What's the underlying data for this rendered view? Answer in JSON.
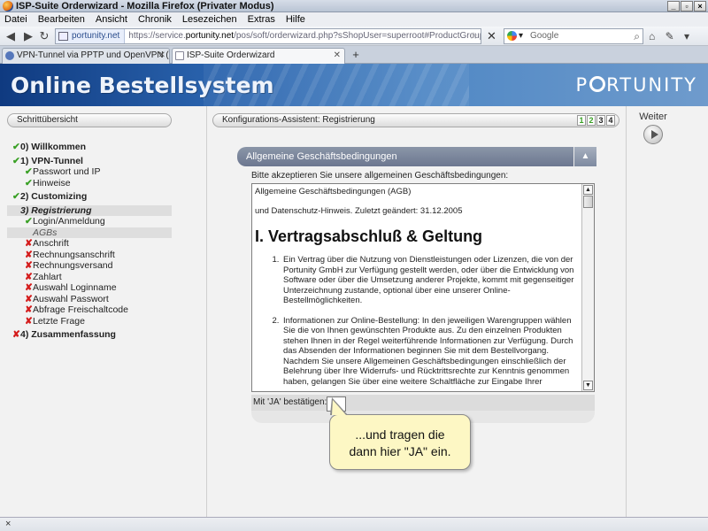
{
  "window": {
    "title": "ISP-Suite Orderwizard - Mozilla Firefox (Privater Modus)",
    "controls": [
      "_",
      "▫",
      "×"
    ]
  },
  "menu": [
    "Datei",
    "Bearbeiten",
    "Ansicht",
    "Chronik",
    "Lesezeichen",
    "Extras",
    "Hilfe"
  ],
  "nav": {
    "site_identity": "portunity.net",
    "url_prefix": "https://service.",
    "url_domain": "portunity.net",
    "url_path": "/pos/soft/orderwizard.php?sShopUser=superroot#ProductGroup=96",
    "search_placeholder": "Google"
  },
  "tabs": [
    {
      "label": "VPN-Tunnel via PPTP und OpenVPN (Tarif...",
      "active": false
    },
    {
      "label": "ISP-Suite Orderwizard",
      "active": true
    }
  ],
  "banner": {
    "title": "Online Bestellsystem",
    "logo_pre": "P",
    "logo_post": "RTUNITY"
  },
  "sidebar": {
    "header": "Schrittübersicht",
    "steps": [
      {
        "label": "0) Willkommen",
        "status": "ok",
        "level": "main"
      },
      {
        "label": "1) VPN-Tunnel",
        "status": "ok",
        "level": "main"
      },
      {
        "label": "Passwort und IP",
        "status": "ok",
        "level": "sub"
      },
      {
        "label": "Hinweise",
        "status": "ok",
        "level": "sub"
      },
      {
        "label": "2) Customizing",
        "status": "ok",
        "level": "main"
      },
      {
        "label": "3) Registrierung",
        "status": "current",
        "level": "main"
      },
      {
        "label": "Login/Anmeldung",
        "status": "ok",
        "level": "sub"
      },
      {
        "label": "AGBs",
        "status": "current",
        "level": "sub"
      },
      {
        "label": "Anschrift",
        "status": "no",
        "level": "sub"
      },
      {
        "label": "Rechnungsanschrift",
        "status": "no",
        "level": "sub"
      },
      {
        "label": "Rechnungsversand",
        "status": "no",
        "level": "sub"
      },
      {
        "label": "Zahlart",
        "status": "no",
        "level": "sub"
      },
      {
        "label": "Auswahl Loginname",
        "status": "no",
        "level": "sub"
      },
      {
        "label": "Auswahl Passwort",
        "status": "no",
        "level": "sub"
      },
      {
        "label": "Abfrage Freischaltcode",
        "status": "no",
        "level": "sub"
      },
      {
        "label": "Letzte Frage",
        "status": "no",
        "level": "sub"
      },
      {
        "label": "4) Zusammenfassung",
        "status": "no",
        "level": "main"
      }
    ]
  },
  "wizard": {
    "header": "Konfigurations-Assistent: Registrierung",
    "stepper": [
      {
        "n": "1",
        "done": true
      },
      {
        "n": "2",
        "done": true
      },
      {
        "n": "3",
        "done": false
      },
      {
        "n": "4",
        "done": false
      }
    ]
  },
  "agb": {
    "panel_title": "Allgemeine Geschäftsbedingungen",
    "prompt": "Bitte akzeptieren Sie unsere allgemeinen Geschäftsbedingungen:",
    "doc_title": "Allgemeine Geschäftsbedingungen (AGB)",
    "doc_note": "und Datenschutz-Hinweis. Zuletzt geändert: 31.12.2005",
    "heading": "I. Vertragsabschluß & Geltung",
    "items": [
      "Ein Vertrag über die Nutzung von Dienstleistungen oder Lizenzen, die von der Portunity GmbH zur Verfügung gestellt werden, oder über die Entwicklung von Software oder über die Umsetzung anderer Projekte, kommt mit gegenseitiger Unterzeichnung zustande, optional über eine unserer Online-Bestellmöglichkeiten.",
      "Informationen zur Online-Bestellung: In den jeweiligen Warengruppen wählen Sie die von Ihnen gewünschten Produkte aus. Zu den einzelnen Produkten stehen Ihnen in der Regel weiterführende Informationen zur Verfügung. Durch das Absenden der Informationen beginnen Sie mit dem Bestellvorgang. Nachdem Sie unsere Allgemeinen Geschäftsbedingungen einschließlich der Belehrung über Ihre Widerrufs- und Rücktrittsrechte zur Kenntnis genommen haben, gelangen Sie über eine weitere Schaltfläche zur Eingabe Ihrer"
    ],
    "confirm_label": "Mit 'JA' bestätigen:",
    "confirm_value": ""
  },
  "callout": {
    "line1": "...und tragen die",
    "line2": "dann hier \"JA\" ein."
  },
  "right": {
    "next_label": "Weiter"
  },
  "statusbar": {
    "text": "×"
  }
}
